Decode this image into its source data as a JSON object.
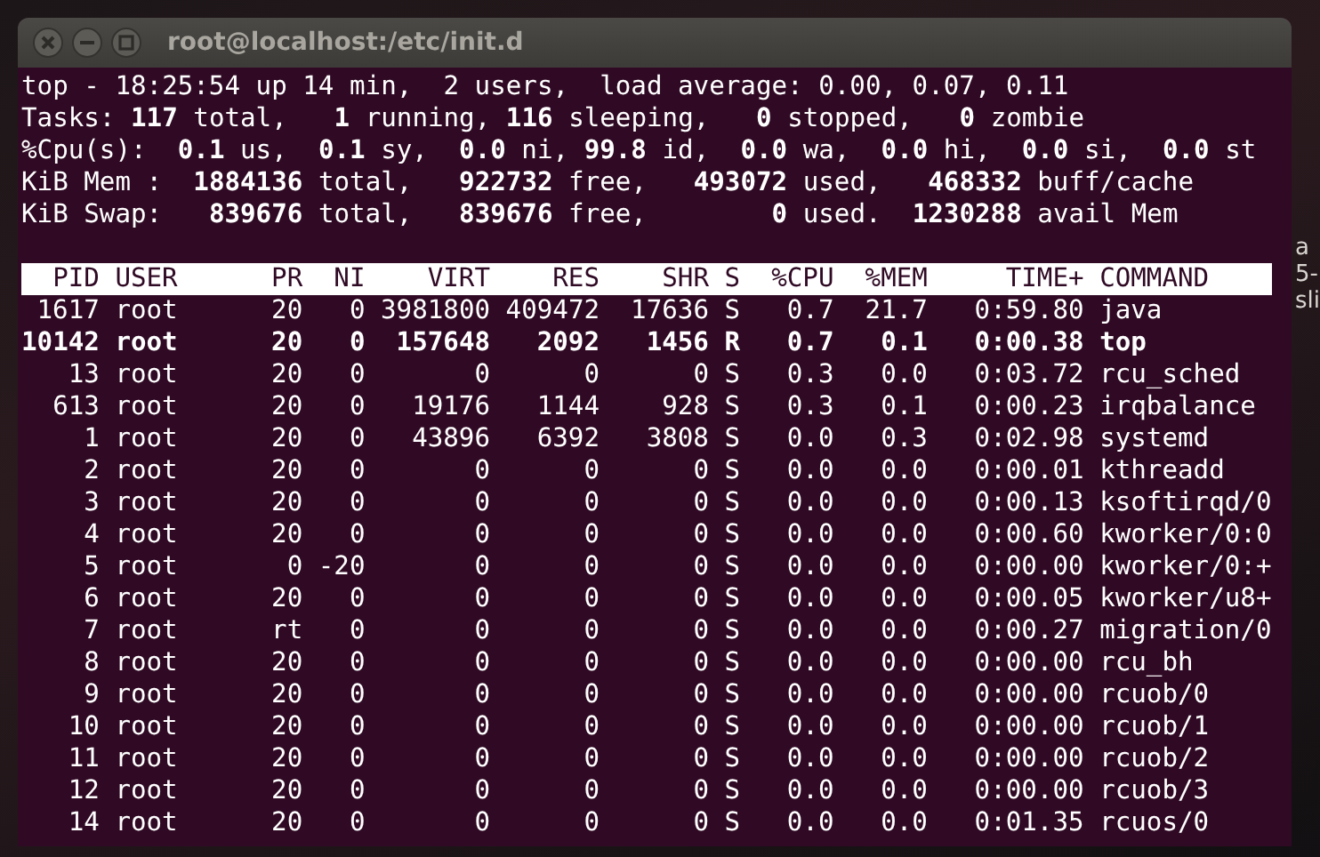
{
  "window": {
    "title": "root@localhost:/etc/init.d"
  },
  "summary": [
    "top - 18:25:54 up 14 min,  2 users,  load average: 0.00, 0.07, 0.11",
    "Tasks: **117** total,   **1** running, **116** sleeping,   **0** stopped,   **0** zombie",
    "%Cpu(s):  **0.1** us,  **0.1** sy,  **0.0** ni, **99.8** id,  **0.0** wa,  **0.0** hi,  **0.0** si,  **0.0** st",
    "KiB Mem :  **1884136** total,   **922732** free,   **493072** used,   **468332** buff/cache",
    "KiB Swap:   **839676** total,   **839676** free,        **0** used.  **1230288** avail Mem"
  ],
  "table": {
    "columns": [
      "PID",
      "USER",
      "PR",
      "NI",
      "VIRT",
      "RES",
      "SHR",
      "S",
      "%CPU",
      "%MEM",
      "TIME+",
      "COMMAND"
    ],
    "rows": [
      {
        "highlighted": false,
        "cells": [
          "1617",
          "root",
          "20",
          "0",
          "3981800",
          "409472",
          "17636",
          "S",
          "0.7",
          "21.7",
          "0:59.80",
          "java"
        ]
      },
      {
        "highlighted": true,
        "cells": [
          "10142",
          "root",
          "20",
          "0",
          "157648",
          "2092",
          "1456",
          "R",
          "0.7",
          "0.1",
          "0:00.38",
          "top"
        ]
      },
      {
        "highlighted": false,
        "cells": [
          "13",
          "root",
          "20",
          "0",
          "0",
          "0",
          "0",
          "S",
          "0.3",
          "0.0",
          "0:03.72",
          "rcu_sched"
        ]
      },
      {
        "highlighted": false,
        "cells": [
          "613",
          "root",
          "20",
          "0",
          "19176",
          "1144",
          "928",
          "S",
          "0.3",
          "0.1",
          "0:00.23",
          "irqbalance"
        ]
      },
      {
        "highlighted": false,
        "cells": [
          "1",
          "root",
          "20",
          "0",
          "43896",
          "6392",
          "3808",
          "S",
          "0.0",
          "0.3",
          "0:02.98",
          "systemd"
        ]
      },
      {
        "highlighted": false,
        "cells": [
          "2",
          "root",
          "20",
          "0",
          "0",
          "0",
          "0",
          "S",
          "0.0",
          "0.0",
          "0:00.01",
          "kthreadd"
        ]
      },
      {
        "highlighted": false,
        "cells": [
          "3",
          "root",
          "20",
          "0",
          "0",
          "0",
          "0",
          "S",
          "0.0",
          "0.0",
          "0:00.13",
          "ksoftirqd/0"
        ]
      },
      {
        "highlighted": false,
        "cells": [
          "4",
          "root",
          "20",
          "0",
          "0",
          "0",
          "0",
          "S",
          "0.0",
          "0.0",
          "0:00.60",
          "kworker/0:0"
        ]
      },
      {
        "highlighted": false,
        "cells": [
          "5",
          "root",
          "0",
          "-20",
          "0",
          "0",
          "0",
          "S",
          "0.0",
          "0.0",
          "0:00.00",
          "kworker/0:+"
        ]
      },
      {
        "highlighted": false,
        "cells": [
          "6",
          "root",
          "20",
          "0",
          "0",
          "0",
          "0",
          "S",
          "0.0",
          "0.0",
          "0:00.05",
          "kworker/u8+"
        ]
      },
      {
        "highlighted": false,
        "cells": [
          "7",
          "root",
          "rt",
          "0",
          "0",
          "0",
          "0",
          "S",
          "0.0",
          "0.0",
          "0:00.27",
          "migration/0"
        ]
      },
      {
        "highlighted": false,
        "cells": [
          "8",
          "root",
          "20",
          "0",
          "0",
          "0",
          "0",
          "S",
          "0.0",
          "0.0",
          "0:00.00",
          "rcu_bh"
        ]
      },
      {
        "highlighted": false,
        "cells": [
          "9",
          "root",
          "20",
          "0",
          "0",
          "0",
          "0",
          "S",
          "0.0",
          "0.0",
          "0:00.00",
          "rcuob/0"
        ]
      },
      {
        "highlighted": false,
        "cells": [
          "10",
          "root",
          "20",
          "0",
          "0",
          "0",
          "0",
          "S",
          "0.0",
          "0.0",
          "0:00.00",
          "rcuob/1"
        ]
      },
      {
        "highlighted": false,
        "cells": [
          "11",
          "root",
          "20",
          "0",
          "0",
          "0",
          "0",
          "S",
          "0.0",
          "0.0",
          "0:00.00",
          "rcuob/2"
        ]
      },
      {
        "highlighted": false,
        "cells": [
          "12",
          "root",
          "20",
          "0",
          "0",
          "0",
          "0",
          "S",
          "0.0",
          "0.0",
          "0:00.00",
          "rcuob/3"
        ]
      },
      {
        "highlighted": false,
        "cells": [
          "14",
          "root",
          "20",
          "0",
          "0",
          "0",
          "0",
          "S",
          "0.0",
          "0.0",
          "0:01.35",
          "rcuos/0"
        ]
      }
    ]
  },
  "background_fragments": [
    "a",
    "5-",
    "sli"
  ]
}
